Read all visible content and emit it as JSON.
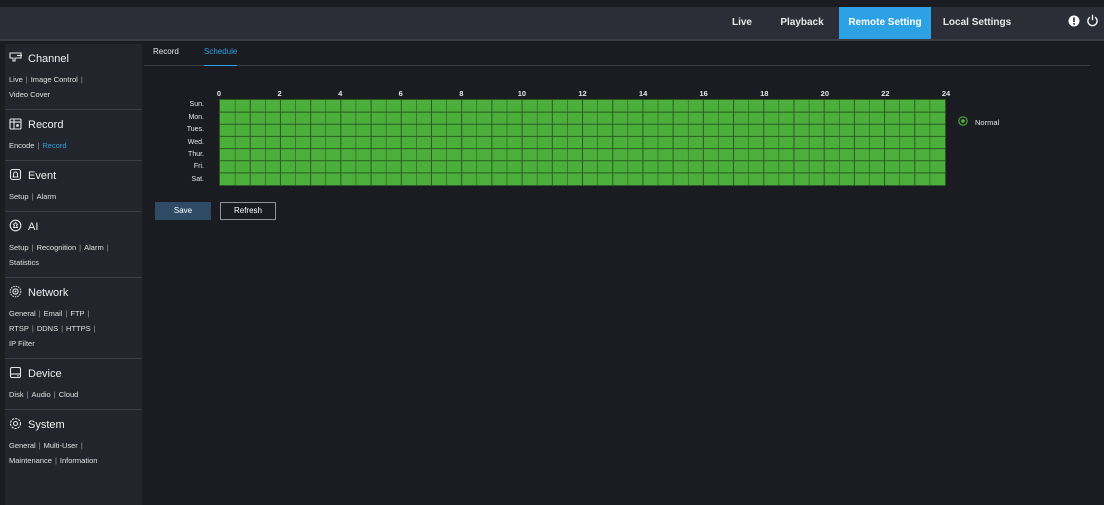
{
  "topnav": {
    "items": [
      {
        "label": "Live",
        "active": false
      },
      {
        "label": "Playback",
        "active": false
      },
      {
        "label": "Remote Setting",
        "active": true
      },
      {
        "label": "Local Settings",
        "active": false
      }
    ],
    "icons": [
      "alert-icon",
      "power-icon"
    ],
    "accent_color": "#2ca1e4"
  },
  "sidebar": {
    "sections": [
      {
        "title": "Channel",
        "icon": "channel-icon",
        "links": [
          [
            "Live",
            "Image Control"
          ],
          [
            "Video Cover"
          ]
        ]
      },
      {
        "title": "Record",
        "icon": "record-icon",
        "links": [
          [
            "Encode",
            "Record"
          ]
        ],
        "active_link": "Record"
      },
      {
        "title": "Event",
        "icon": "event-icon",
        "links": [
          [
            "Setup",
            "Alarm"
          ]
        ]
      },
      {
        "title": "AI",
        "icon": "ai-icon",
        "links": [
          [
            "Setup",
            "Recognition",
            "Alarm"
          ],
          [
            "Statistics"
          ]
        ]
      },
      {
        "title": "Network",
        "icon": "network-icon",
        "links": [
          [
            "General",
            "Email",
            "FTP"
          ],
          [
            "RTSP",
            "DDNS",
            "HTTPS"
          ],
          [
            "IP Filter"
          ]
        ]
      },
      {
        "title": "Device",
        "icon": "device-icon",
        "links": [
          [
            "Disk",
            "Audio",
            "Cloud"
          ]
        ]
      },
      {
        "title": "System",
        "icon": "system-icon",
        "links": [
          [
            "General",
            "Multi-User"
          ],
          [
            "Maintenance",
            "Information"
          ]
        ]
      }
    ]
  },
  "tabs": [
    {
      "label": "Record",
      "active": false
    },
    {
      "label": "Schedule",
      "active": true
    }
  ],
  "schedule": {
    "hours": [
      "0",
      "2",
      "4",
      "6",
      "8",
      "10",
      "12",
      "14",
      "16",
      "18",
      "20",
      "22",
      "24"
    ],
    "days": [
      "Sun.",
      "Mon.",
      "Tues.",
      "Wed.",
      "Thur.",
      "Fri.",
      "Sat."
    ],
    "fill_color": "#4caf3b",
    "all_cells_scheduled": true,
    "legend": {
      "label": "Normal",
      "color": "#4caf3b"
    }
  },
  "buttons": {
    "save": "Save",
    "refresh": "Refresh"
  }
}
